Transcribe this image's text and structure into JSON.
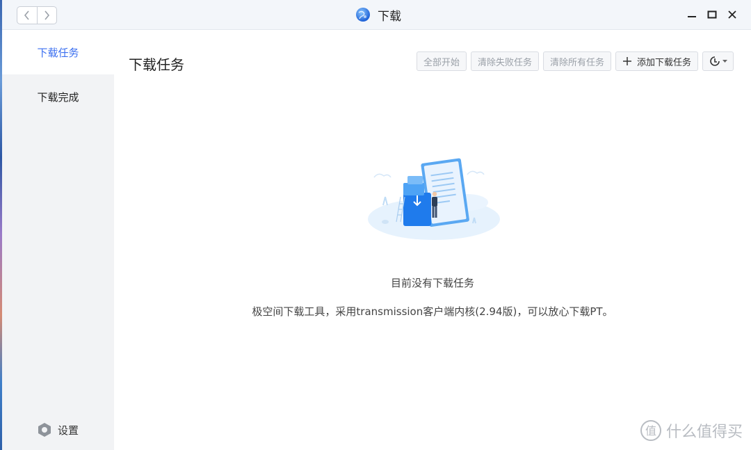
{
  "window": {
    "title": "下载"
  },
  "sidebar": {
    "items": [
      {
        "label": "下载任务",
        "active": true
      },
      {
        "label": "下载完成",
        "active": false
      }
    ],
    "settings_label": "设置"
  },
  "main": {
    "title": "下载任务",
    "toolbar": {
      "start_all": "全部开始",
      "clear_failed": "清除失败任务",
      "clear_all": "清除所有任务",
      "add_task": "添加下载任务"
    },
    "empty": {
      "title": "目前没有下载任务",
      "description": "极空间下载工具，采用transmission客户端内核(2.94版)，可以放心下载PT。"
    }
  },
  "watermark": {
    "text": "什么值得买",
    "badge": "值"
  },
  "colors": {
    "accent": "#3b6ff0",
    "sidebar_bg": "#f2f3f5",
    "titlebar_bg": "#f3f6fa"
  },
  "icons": [
    "chevron-left-icon",
    "chevron-right-icon",
    "globe-app-icon",
    "minimize-icon",
    "maximize-icon",
    "close-icon",
    "settings-gear-icon",
    "plus-icon",
    "speed-limit-icon",
    "caret-down-icon"
  ]
}
